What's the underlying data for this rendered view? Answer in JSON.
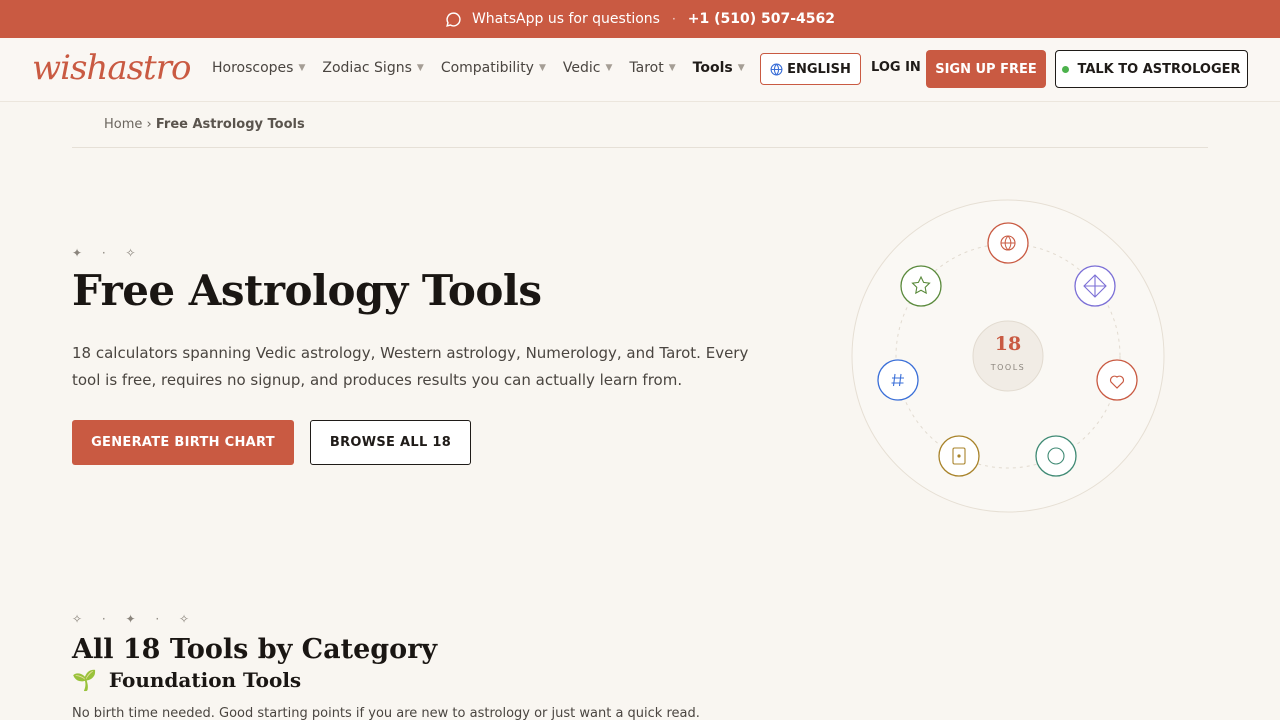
{
  "topbar": {
    "whatsapp_text": "WhatsApp us for questions",
    "separator": "·",
    "phone": "+1 (510) 507-4562"
  },
  "nav": {
    "logo": "wishastro",
    "menu": [
      {
        "label": "Horoscopes"
      },
      {
        "label": "Zodiac Signs"
      },
      {
        "label": "Compatibility"
      },
      {
        "label": "Vedic"
      },
      {
        "label": "Tarot"
      },
      {
        "label": "Tools"
      }
    ],
    "language": "ENGLISH",
    "login": "LOG IN",
    "signup": "SIGN UP FREE",
    "talk": "TALK TO ASTROLOGER"
  },
  "breadcrumb": {
    "home": "Home",
    "separator": "›",
    "current": "Free Astrology Tools"
  },
  "hero": {
    "sparkles": "✦ · ✧",
    "title": "Free Astrology Tools",
    "description": "18 calculators spanning Vedic astrology, Western astrology, Numerology, and Tarot. Every tool is free, requires no signup, and produces results you can actually learn from.",
    "primary_button": "GENERATE BIRTH CHART",
    "secondary_button": "BROWSE ALL 18"
  },
  "wheel": {
    "count": "18",
    "caption": "TOOLS",
    "icons": [
      "globe-icon",
      "diamond-icon",
      "heart-icon",
      "circle-icon",
      "card-icon",
      "hash-icon",
      "star-icon"
    ],
    "colors": {
      "globe": "#c95a42",
      "diamond": "#7b6fd6",
      "heart": "#c95a42",
      "circle": "#3f8a74",
      "card": "#a8832a",
      "hash": "#3a6fd8",
      "star": "#5a8a3c"
    }
  },
  "categories": {
    "sparkles": "✧ · ✦ · ✧",
    "title": "All 18 Tools by Category",
    "foundation": {
      "icon": "🌱",
      "title": "Foundation Tools",
      "description": "No birth time needed. Good starting points if you are new to astrology or just want a quick read."
    }
  },
  "colors": {
    "accent": "#c95a42",
    "background": "#f9f6f1",
    "text": "#1f1b18"
  }
}
